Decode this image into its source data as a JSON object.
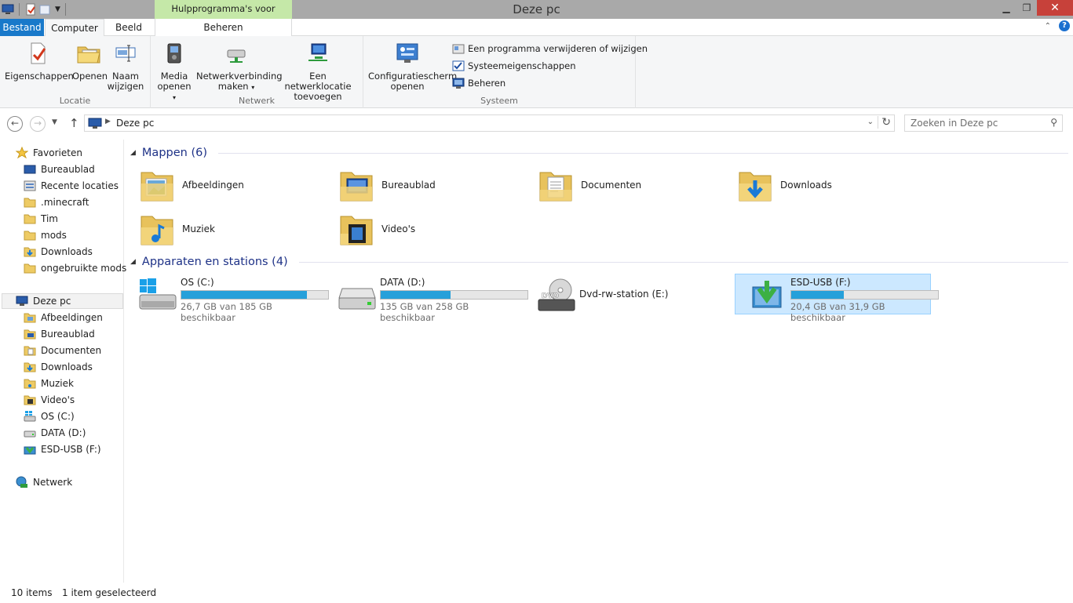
{
  "window": {
    "title": "Deze pc",
    "context_group": "Hulpprogramma's voor stations"
  },
  "tabs": {
    "file": "Bestand",
    "computer": "Computer",
    "view": "Beeld",
    "manage": "Beheren"
  },
  "ribbon": {
    "location": {
      "label": "Locatie",
      "properties": "Eigenschappen",
      "open": "Openen",
      "rename_1": "Naam",
      "rename_2": "wijzigen"
    },
    "network": {
      "label": "Netwerk",
      "media_1": "Media",
      "media_2": "openen",
      "map_1": "Netwerkverbinding",
      "map_2": "maken",
      "add_1": "Een netwerklocatie",
      "add_2": "toevoegen"
    },
    "system": {
      "label": "Systeem",
      "control_1": "Configuratiescherm",
      "control_2": "openen",
      "uninstall": "Een programma verwijderen of wijzigen",
      "properties": "Systeemeigenschappen",
      "manage": "Beheren"
    }
  },
  "address": {
    "path": "Deze pc",
    "search_placeholder": "Zoeken in Deze pc"
  },
  "sidebar": {
    "favorites": "Favorieten",
    "fav_items": [
      "Bureaublad",
      "Recente locaties",
      ".minecraft",
      "Tim",
      "mods",
      "Downloads",
      "ongebruikte mods"
    ],
    "this_pc": "Deze pc",
    "pc_items": [
      "Afbeeldingen",
      "Bureaublad",
      "Documenten",
      "Downloads",
      "Muziek",
      "Video's",
      "OS (C:)",
      "DATA (D:)",
      "ESD-USB (F:)"
    ],
    "network": "Netwerk"
  },
  "content": {
    "folders_header": "Mappen (6)",
    "folders": [
      "Afbeeldingen",
      "Bureaublad",
      "Documenten",
      "Downloads",
      "Muziek",
      "Video's"
    ],
    "devices_header": "Apparaten en stations (4)",
    "drives": [
      {
        "name": "OS (C:)",
        "free": "26,7 GB van 185 GB beschikbaar",
        "used_fraction": 0.856
      },
      {
        "name": "DATA (D:)",
        "free": "135 GB van 258 GB beschikbaar",
        "used_fraction": 0.477
      },
      {
        "name": "Dvd-rw-station (E:)"
      },
      {
        "name": "ESD-USB (F:)",
        "free": "20,4 GB van 31,9 GB beschikbaar",
        "used_fraction": 0.36
      }
    ]
  },
  "status": {
    "items": "10 items",
    "selected": "1 item geselecteerd"
  }
}
